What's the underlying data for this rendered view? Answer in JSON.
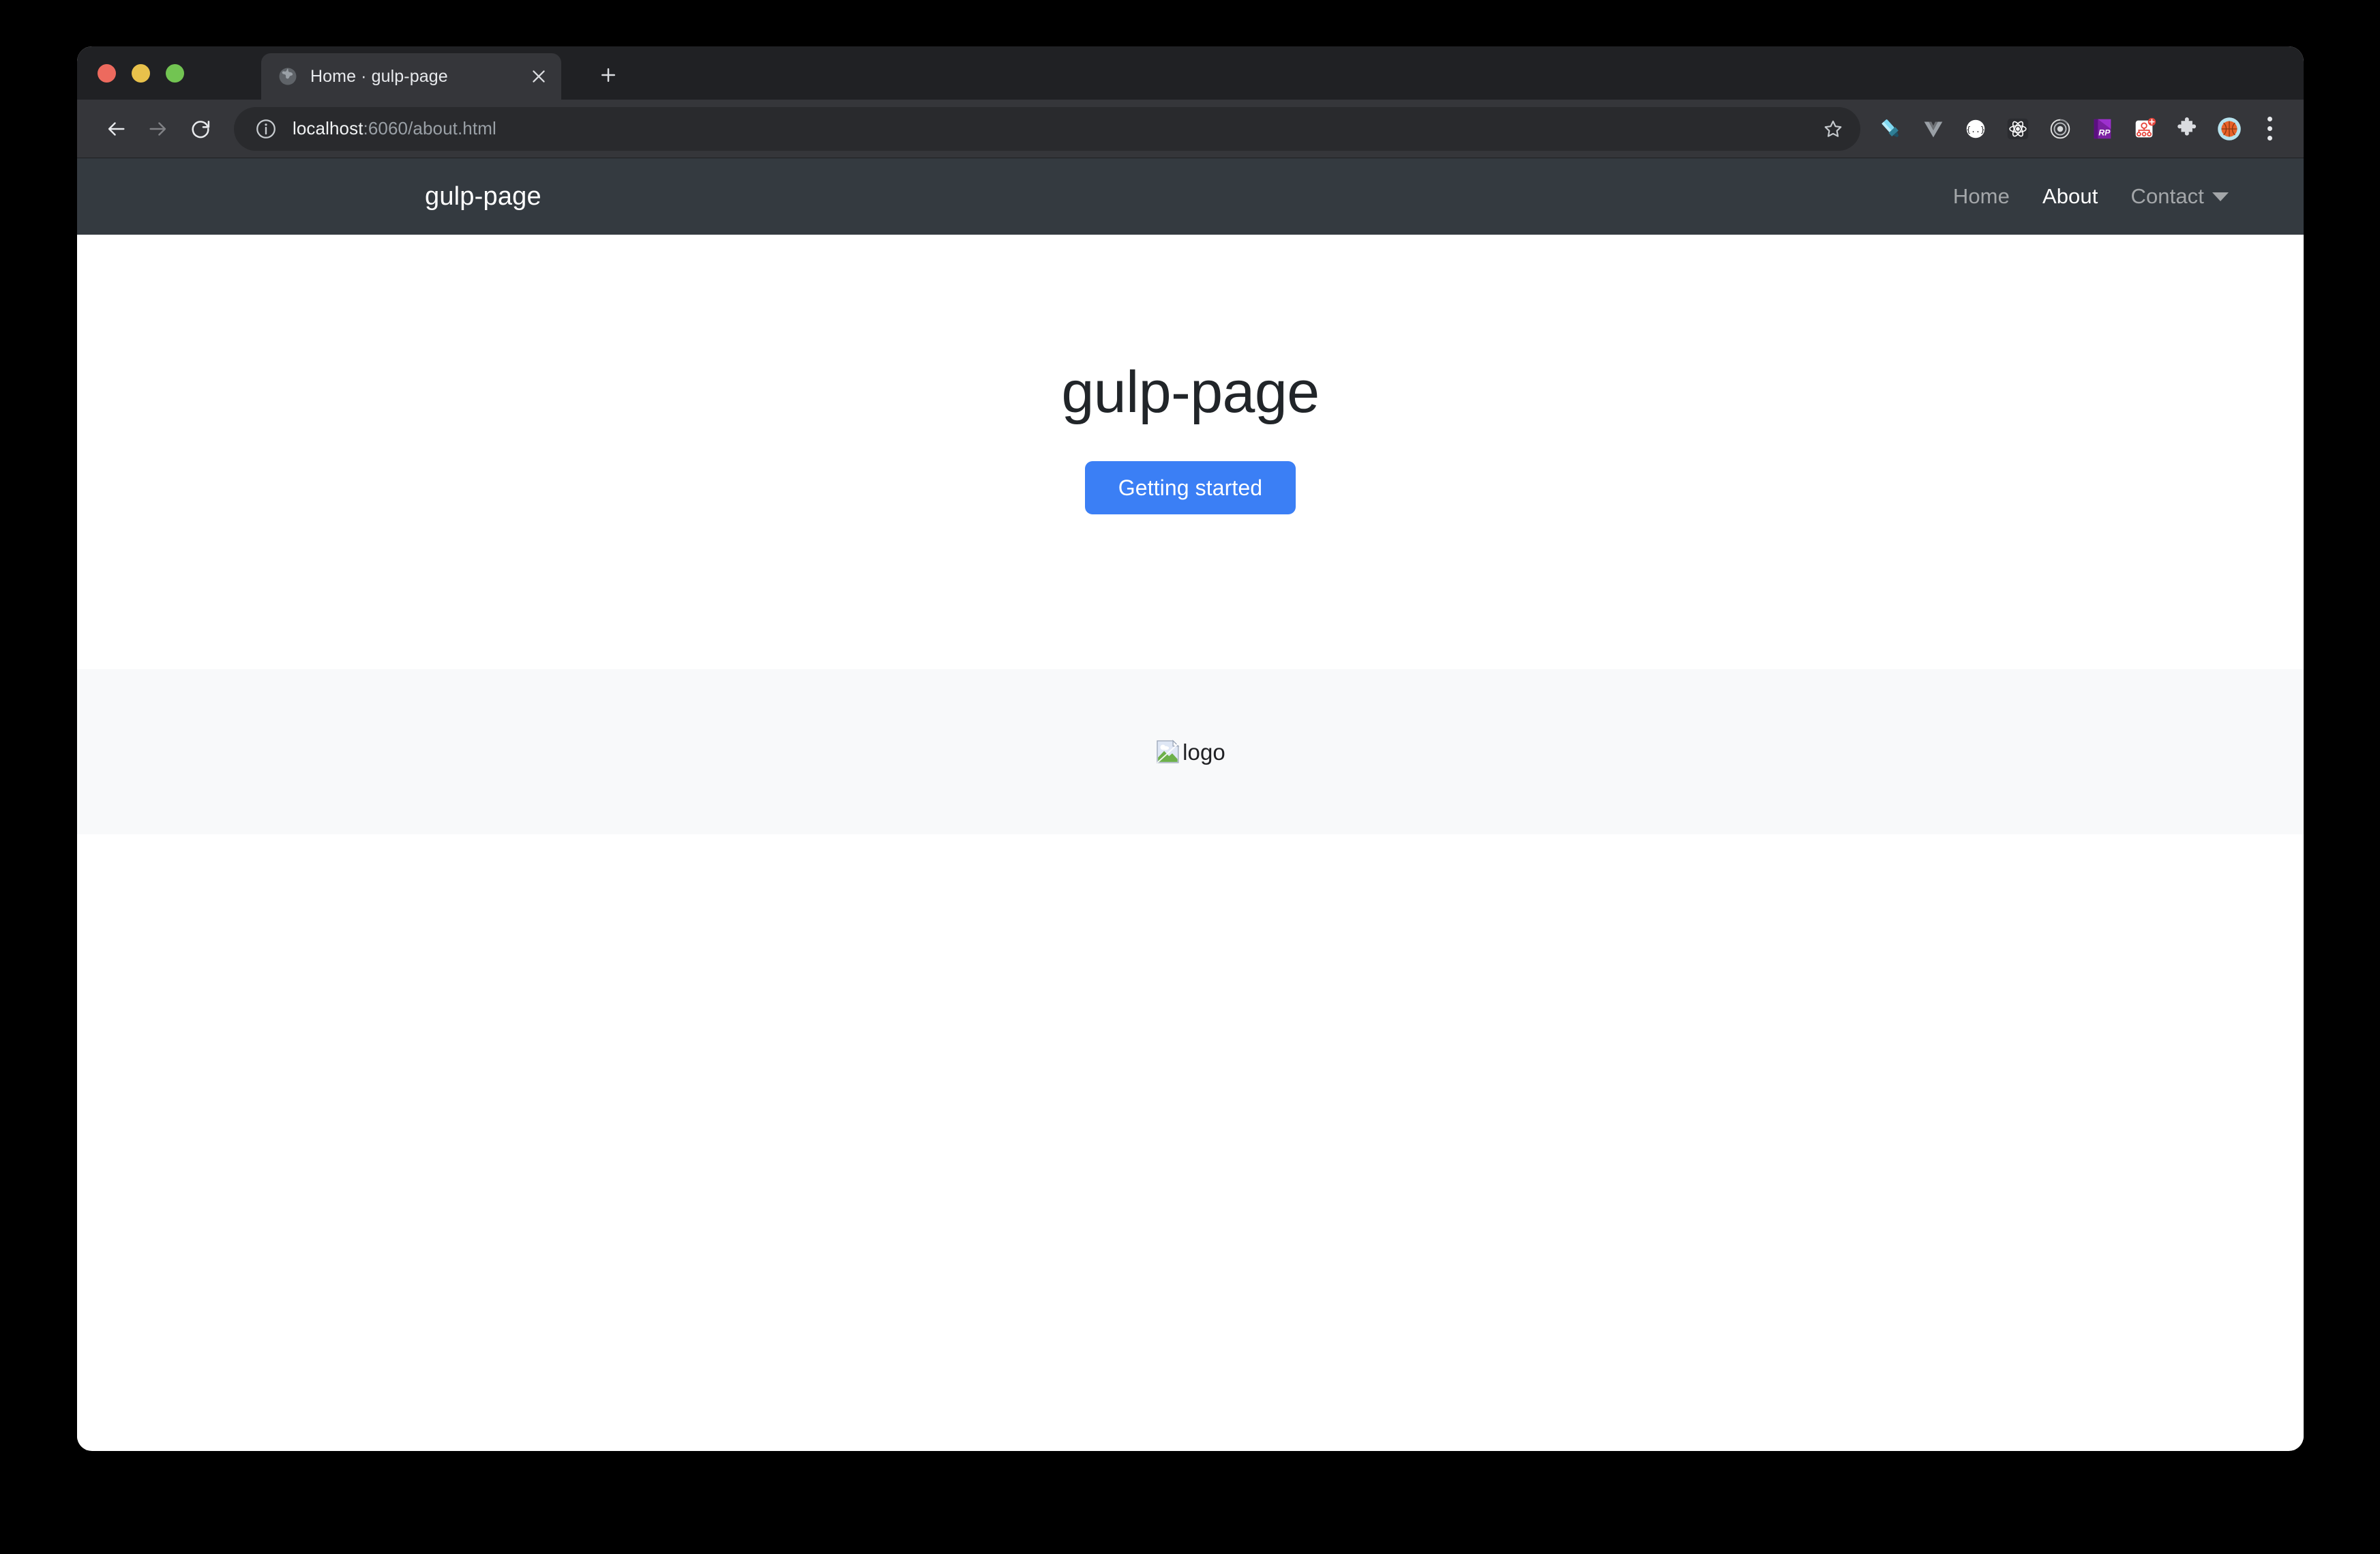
{
  "browser": {
    "tab": {
      "title": "Home · gulp-page",
      "favicon": "globe-icon",
      "close_label": "×"
    },
    "new_tab_label": "+",
    "toolbar": {
      "back_label": "Back",
      "forward_label": "Forward",
      "reload_label": "Reload",
      "site_info_label": "View site information",
      "url": "localhost:6060/about.html",
      "url_host": "localhost",
      "url_path": ":6060/about.html",
      "bookmark_label": "Bookmark this tab",
      "menu_label": "Customize and control Google Chrome",
      "extensions": [
        {
          "name": "highlighter-icon",
          "title": "Highlighter"
        },
        {
          "name": "vue-devtools-icon",
          "title": "Vue.js devtools"
        },
        {
          "name": "json-viewer-icon",
          "title": "JSON Viewer"
        },
        {
          "name": "react-devtools-icon",
          "title": "React Developer Tools"
        },
        {
          "name": "target-icon",
          "title": "Target"
        },
        {
          "name": "rp-icon",
          "title": "RP"
        },
        {
          "name": "sitemap-add-icon",
          "title": "Sitemap"
        },
        {
          "name": "extensions-puzzle-icon",
          "title": "Extensions"
        },
        {
          "name": "profile-avatar-basketball",
          "title": "Profile"
        }
      ]
    }
  },
  "page": {
    "navbar": {
      "brand": "gulp-page",
      "links": [
        {
          "label": "Home",
          "active": false,
          "dropdown": false
        },
        {
          "label": "About",
          "active": true,
          "dropdown": false
        },
        {
          "label": "Contact",
          "active": false,
          "dropdown": true
        }
      ]
    },
    "hero": {
      "title": "gulp-page",
      "cta_label": "Getting started"
    },
    "logo_band": {
      "image_alt": "logo",
      "image_state": "broken"
    }
  },
  "colors": {
    "navbar_bg": "#343a40",
    "primary_button": "#3b7ff5",
    "band_bg": "#f8f9fa",
    "heading": "#212529",
    "browser_tabstrip": "#202124",
    "browser_toolbar": "#35363a",
    "omnibox": "#292a2d"
  }
}
